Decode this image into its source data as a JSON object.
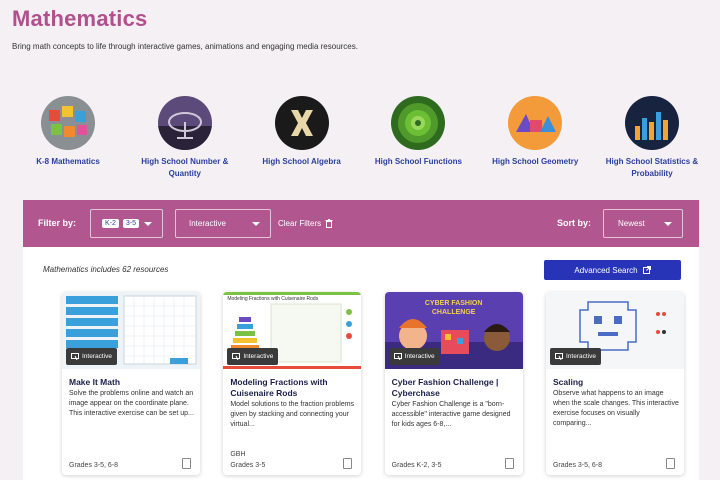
{
  "page": {
    "title": "Mathematics",
    "description": "Bring math concepts to life through interactive games, animations and engaging media resources."
  },
  "subjects": [
    {
      "label": "K-8 Mathematics",
      "icon": "math-blocks-icon"
    },
    {
      "label": "High School Number & Quantity",
      "icon": "radio-telescope-icon"
    },
    {
      "label": "High School Algebra",
      "icon": "letter-x-icon"
    },
    {
      "label": "High School Functions",
      "icon": "fractal-spiral-icon"
    },
    {
      "label": "High School Geometry",
      "icon": "geometric-shapes-icon"
    },
    {
      "label": "High School Statistics & Probability",
      "icon": "bar-graph-icon"
    }
  ],
  "filters": {
    "filter_label": "Filter by:",
    "grade_chips": [
      "K-2",
      "3-5"
    ],
    "type_value": "Interactive",
    "clear_label": "Clear Filters",
    "sort_label": "Sort by:",
    "sort_value": "Newest"
  },
  "results": {
    "count_text": "Mathematics includes 62 resources",
    "advanced_search_label": "Advanced Search"
  },
  "cards": [
    {
      "title": "Make It Math",
      "description": "Solve the problems online and watch an image appear on the coordinate plane. This interactive exercise can be set up...",
      "publisher": "",
      "grades": "Grades 3-5, 6-8",
      "badge": "Interactive"
    },
    {
      "title": "Modeling Fractions with Cuisenaire Rods",
      "description": "Model solutions to the fraction problems given by stacking and connecting your virtual...",
      "publisher": "GBH",
      "grades": "Grades 3-5",
      "badge": "Interactive",
      "image_caption": "Modeling Fractions with Cuisenaire Rods"
    },
    {
      "title": "Cyber Fashion Challenge | Cyberchase",
      "description": "Cyber Fashion Challenge is a \"born-accessible\" interactive game designed for kids ages 6-8,...",
      "publisher": "",
      "grades": "Grades K-2, 3-5",
      "badge": "Interactive",
      "image_caption": "CYBER FASHION CHALLENGE"
    },
    {
      "title": "Scaling",
      "description": "Observe what happens to an image when the scale changes. This interactive exercise focuses on visually comparing...",
      "publisher": "",
      "grades": "Grades 3-5, 6-8",
      "badge": "Interactive"
    }
  ],
  "colors": {
    "title": "#b0508c",
    "filter_bar": "#b2568f",
    "link": "#2b3f9c",
    "button": "#2734b8"
  }
}
